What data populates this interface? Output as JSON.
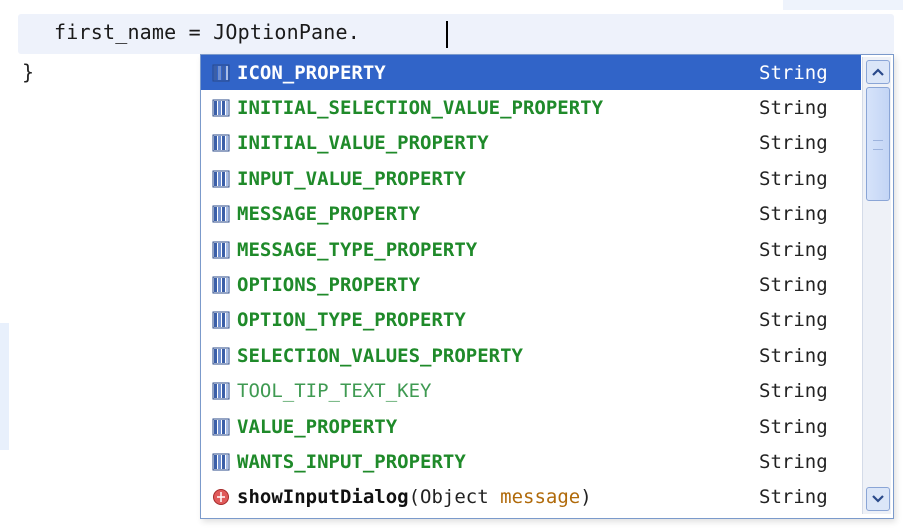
{
  "editor": {
    "code_line": "first_name = JOptionPane.",
    "closing_brace": "}"
  },
  "completion": {
    "items": [
      {
        "name": "ICON_PROPERTY",
        "type": "String",
        "icon": "field-icon",
        "selected": true
      },
      {
        "name": "INITIAL_SELECTION_VALUE_PROPERTY",
        "type": "String",
        "icon": "field-icon"
      },
      {
        "name": "INITIAL_VALUE_PROPERTY",
        "type": "String",
        "icon": "field-icon"
      },
      {
        "name": "INPUT_VALUE_PROPERTY",
        "type": "String",
        "icon": "field-icon"
      },
      {
        "name": "MESSAGE_PROPERTY",
        "type": "String",
        "icon": "field-icon"
      },
      {
        "name": "MESSAGE_TYPE_PROPERTY",
        "type": "String",
        "icon": "field-icon"
      },
      {
        "name": "OPTIONS_PROPERTY",
        "type": "String",
        "icon": "field-icon"
      },
      {
        "name": "OPTION_TYPE_PROPERTY",
        "type": "String",
        "icon": "field-icon"
      },
      {
        "name": "SELECTION_VALUES_PROPERTY",
        "type": "String",
        "icon": "field-icon"
      },
      {
        "name": "TOOL_TIP_TEXT_KEY",
        "type": "String",
        "icon": "field-icon",
        "light": true
      },
      {
        "name": "VALUE_PROPERTY",
        "type": "String",
        "icon": "field-icon"
      },
      {
        "name": "WANTS_INPUT_PROPERTY",
        "type": "String",
        "icon": "field-icon"
      },
      {
        "name": "showInputDialog",
        "open_paren": "(",
        "param_type": "Object ",
        "param_name": "message",
        "close_paren": ")",
        "type": "String",
        "icon": "method-icon",
        "method": true
      }
    ]
  },
  "colors": {
    "selection": "#3164c8",
    "field_text": "#1f8a2a",
    "param_text": "#b06a0a"
  }
}
